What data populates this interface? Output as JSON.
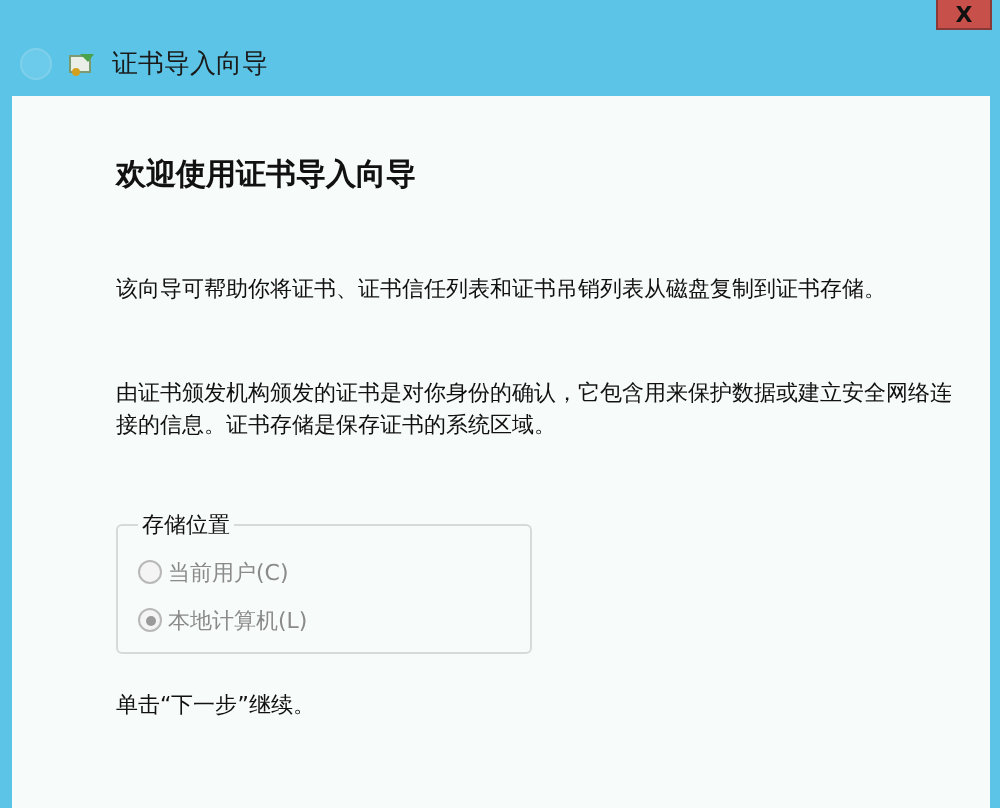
{
  "window": {
    "title": "证书导入向导",
    "close_label": "X"
  },
  "heading": "欢迎使用证书导入向导",
  "paragraphs": [
    "该向导可帮助你将证书、证书信任列表和证书吊销列表从磁盘复制到证书存储。",
    "由证书颁发机构颁发的证书是对你身份的确认，它包含用来保护数据或建立安全网络连接的信息。证书存储是保存证书的系统区域。"
  ],
  "store_location": {
    "legend": "存储位置",
    "options": [
      {
        "label": "当前用户(C)",
        "selected": false,
        "disabled": true
      },
      {
        "label": "本地计算机(L)",
        "selected": true,
        "disabled": true
      }
    ]
  },
  "footer_text": "单击“下一步”继续。"
}
